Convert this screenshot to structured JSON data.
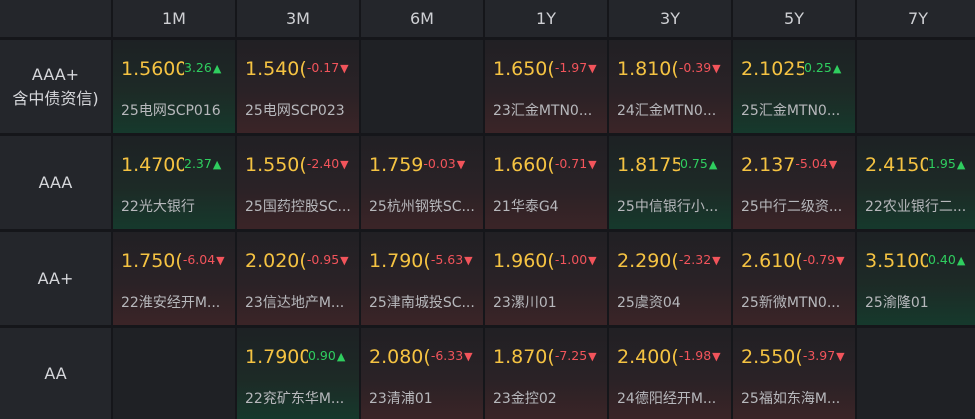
{
  "header": {
    "corner": "",
    "tenors": [
      "1M",
      "3M",
      "6M",
      "1Y",
      "3Y",
      "5Y",
      "7Y"
    ]
  },
  "rows": [
    {
      "label": [
        "AAA+",
        "含中债资信)"
      ],
      "cells": [
        {
          "yield": "1.5600",
          "change": "3.26",
          "dir": "up",
          "name": "25电网SCP016"
        },
        {
          "yield": "1.540(",
          "change": "-0.17",
          "dir": "down",
          "name": "25电网SCP023"
        },
        null,
        {
          "yield": "1.650(",
          "change": "-1.97",
          "dir": "down",
          "name": "23汇金MTN0..."
        },
        {
          "yield": "1.810(",
          "change": "-0.39",
          "dir": "down",
          "name": "24汇金MTN0..."
        },
        {
          "yield": "2.1025",
          "change": "0.25",
          "dir": "up",
          "name": "25汇金MTN0..."
        },
        null
      ]
    },
    {
      "label": [
        "AAA"
      ],
      "cells": [
        {
          "yield": "1.4700",
          "change": "2.37",
          "dir": "up",
          "name": "22光大银行"
        },
        {
          "yield": "1.550(",
          "change": "-2.40",
          "dir": "down",
          "name": "25国药控股SC..."
        },
        {
          "yield": "1.759",
          "change": "-0.03",
          "dir": "down",
          "name": "25杭州钢铁SC..."
        },
        {
          "yield": "1.660(",
          "change": "-0.71",
          "dir": "down",
          "name": "21华泰G4"
        },
        {
          "yield": "1.8175",
          "change": "0.75",
          "dir": "up",
          "name": "25中信银行小..."
        },
        {
          "yield": "2.137",
          "change": "-5.04",
          "dir": "down",
          "name": "25中行二级资..."
        },
        {
          "yield": "2.4150",
          "change": "1.95",
          "dir": "up",
          "name": "22农业银行二..."
        }
      ]
    },
    {
      "label": [
        "AA+"
      ],
      "cells": [
        {
          "yield": "1.750(",
          "change": "-6.04",
          "dir": "down",
          "name": "22淮安经开M..."
        },
        {
          "yield": "2.020(",
          "change": "-0.95",
          "dir": "down",
          "name": "23信达地产M..."
        },
        {
          "yield": "1.790(",
          "change": "-5.63",
          "dir": "down",
          "name": "25津南城投SC..."
        },
        {
          "yield": "1.960(",
          "change": "-1.00",
          "dir": "down",
          "name": "23漯川01"
        },
        {
          "yield": "2.290(",
          "change": "-2.32",
          "dir": "down",
          "name": "25虞资04"
        },
        {
          "yield": "2.610(",
          "change": "-0.79",
          "dir": "down",
          "name": "25新微MTN0..."
        },
        {
          "yield": "3.5100",
          "change": "0.40",
          "dir": "up",
          "name": "25渝隆01"
        }
      ]
    },
    {
      "label": [
        "AA"
      ],
      "cells": [
        null,
        {
          "yield": "1.7900",
          "change": "0.90",
          "dir": "up",
          "name": "22兖矿东华M..."
        },
        {
          "yield": "2.080(",
          "change": "-6.33",
          "dir": "down",
          "name": "23清浦01"
        },
        {
          "yield": "1.870(",
          "change": "-7.25",
          "dir": "down",
          "name": "23金控02"
        },
        {
          "yield": "2.400(",
          "change": "-1.98",
          "dir": "down",
          "name": "24德阳经开M..."
        },
        {
          "yield": "2.550(",
          "change": "-3.97",
          "dir": "down",
          "name": "25福如东海M..."
        },
        null
      ]
    }
  ],
  "glyphs": {
    "up": "▲",
    "down": "▼"
  },
  "colors": {
    "yield": "#f5c342",
    "up": "#2fce5f",
    "down": "#f2545b"
  }
}
